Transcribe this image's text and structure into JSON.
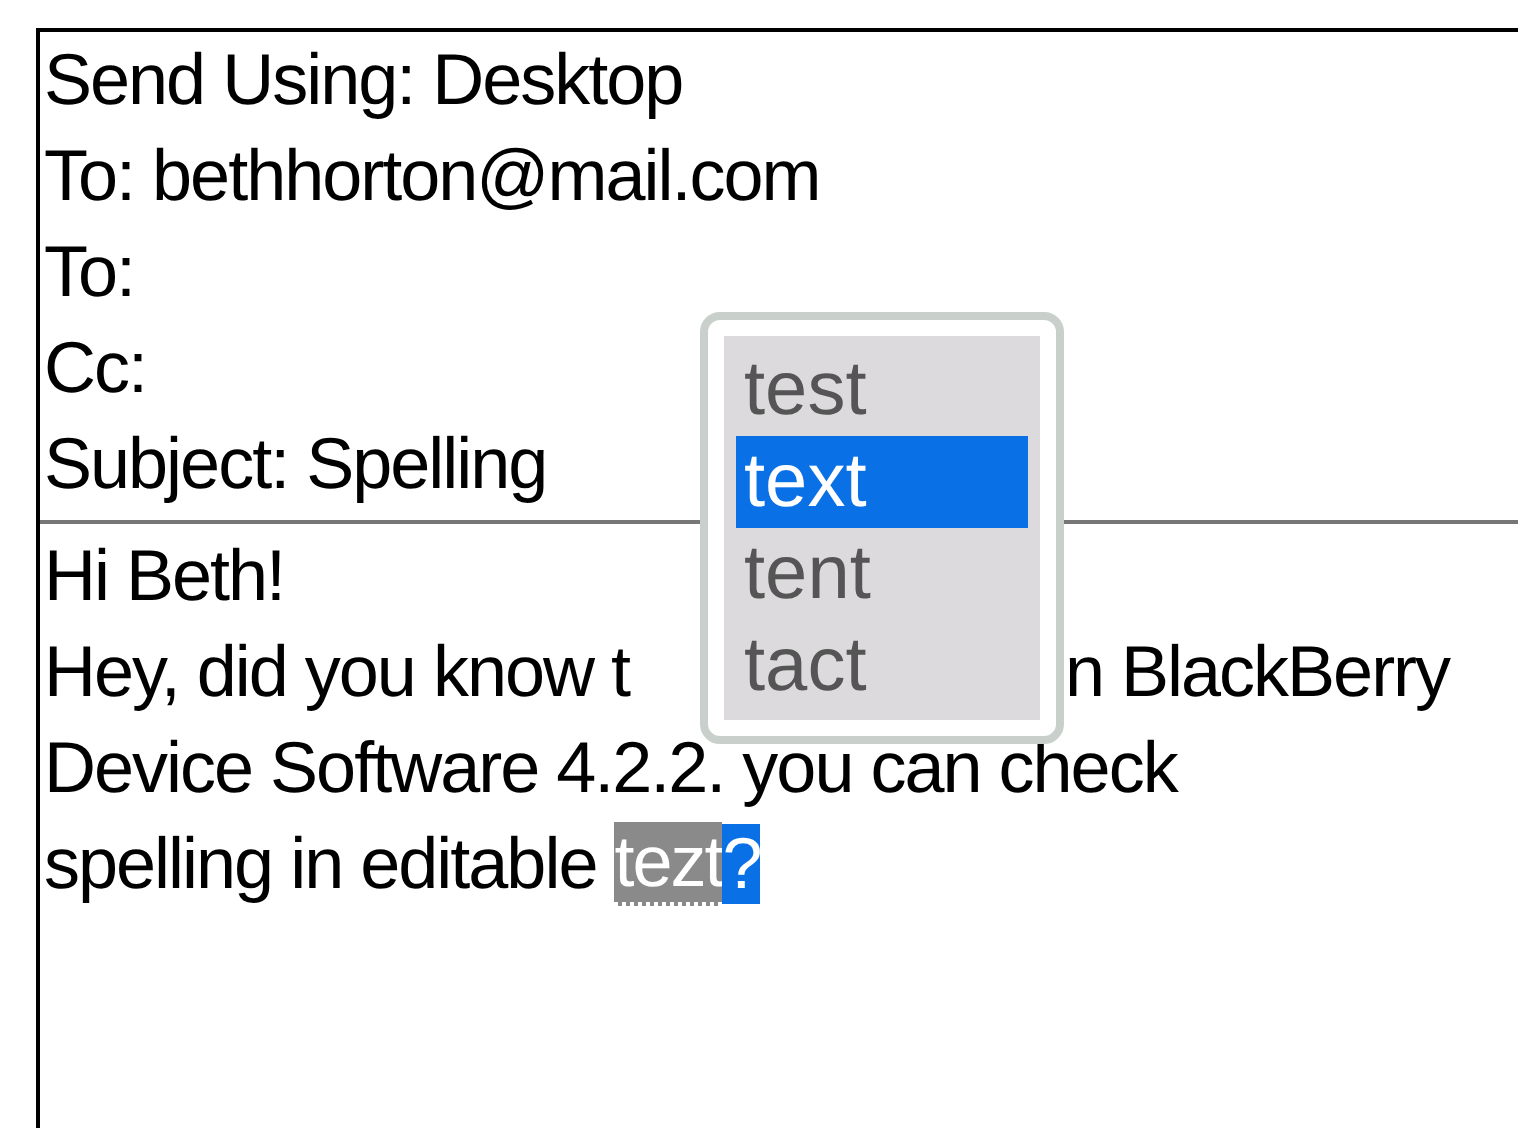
{
  "header_fields": [
    "Send Using: Desktop",
    "To: bethhorton@mail.com",
    "To:",
    "Cc:",
    "Subject: Spelling"
  ],
  "body": {
    "lines": [
      {
        "segments": [
          {
            "kind": "text",
            "text": "Hi Beth!"
          }
        ]
      },
      {
        "segments": [
          {
            "kind": "text",
            "text": "Hey, did you know t"
          },
          {
            "kind": "hidden"
          },
          {
            "kind": "text",
            "text": "n BlackBerry"
          }
        ]
      },
      {
        "segments": [
          {
            "kind": "text",
            "text": "Device Software 4.2.2. you can check"
          }
        ]
      },
      {
        "segments": [
          {
            "kind": "text",
            "text": "spelling in editable "
          },
          {
            "kind": "misspelled",
            "text": "tezt"
          },
          {
            "kind": "cursor",
            "text": "?"
          }
        ]
      }
    ]
  },
  "suggestions": [
    {
      "label": "test",
      "selected": false
    },
    {
      "label": "text",
      "selected": true
    },
    {
      "label": "tent",
      "selected": false
    },
    {
      "label": "tact",
      "selected": false
    }
  ]
}
